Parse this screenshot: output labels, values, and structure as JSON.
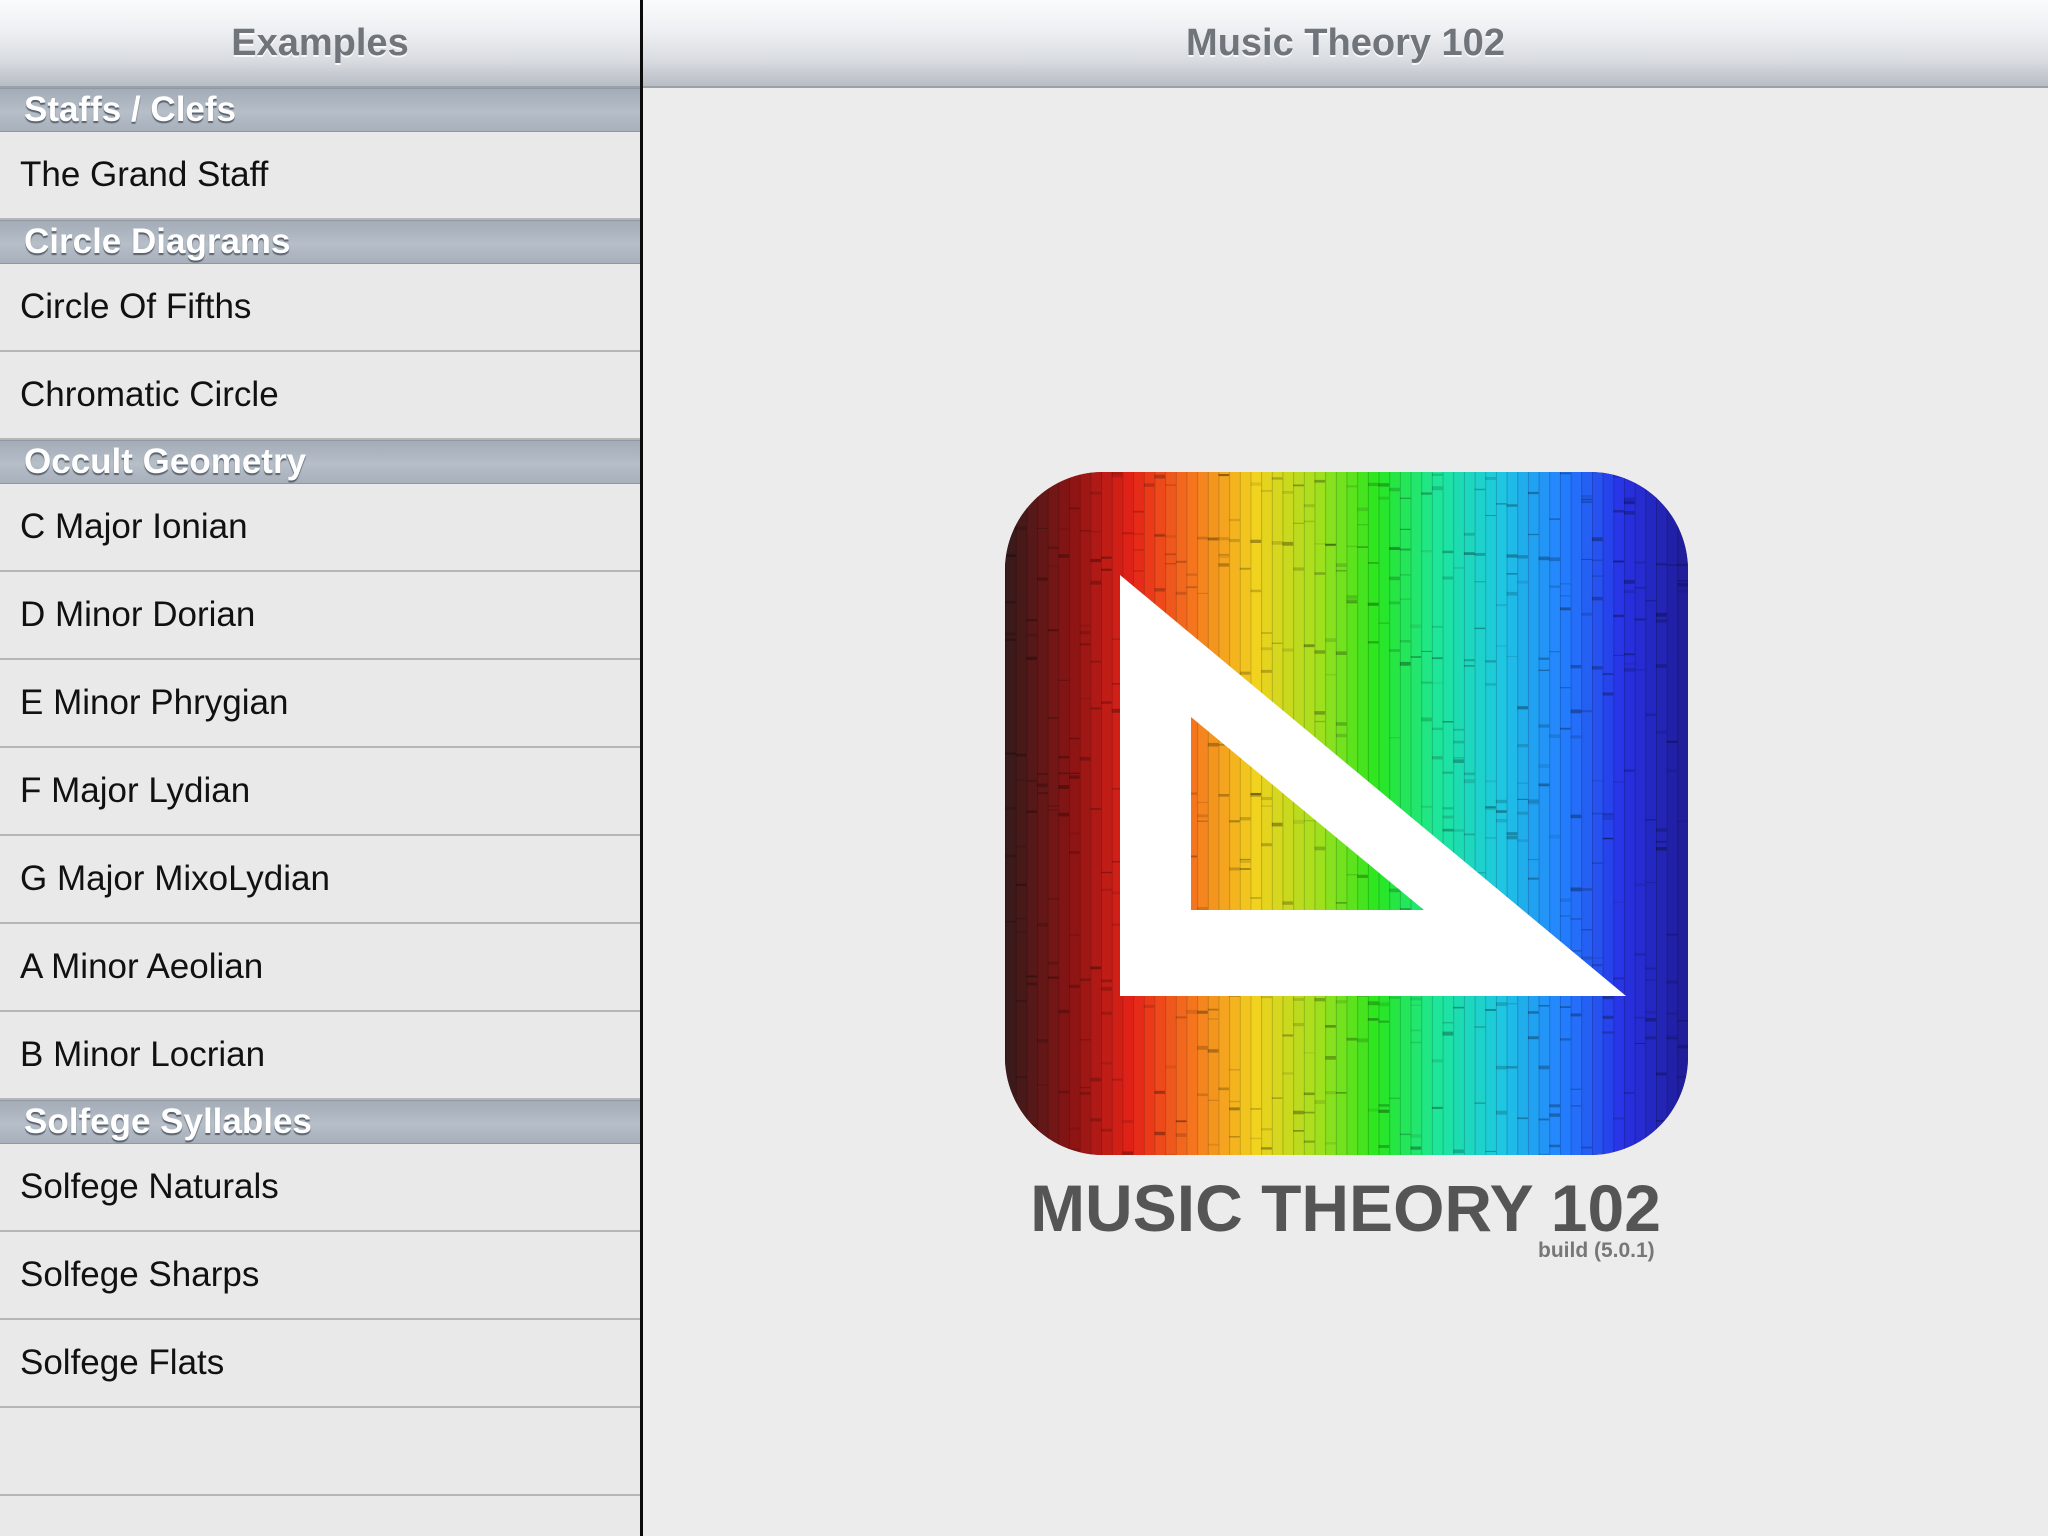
{
  "sidebar": {
    "title": "Examples",
    "sections": [
      {
        "header": "Staffs / Clefs",
        "items": [
          "The Grand Staff"
        ]
      },
      {
        "header": "Circle Diagrams",
        "items": [
          "Circle Of Fifths",
          "Chromatic Circle"
        ]
      },
      {
        "header": "Occult Geometry",
        "items": [
          "C Major Ionian",
          "D Minor Dorian",
          "E Minor Phrygian",
          "F Major Lydian",
          "G Major MixoLydian",
          "A Minor Aeolian",
          "B Minor Locrian"
        ]
      },
      {
        "header": "Solfege Syllables",
        "items": [
          "Solfege Naturals",
          "Solfege Sharps",
          "Solfege Flats"
        ]
      }
    ]
  },
  "main": {
    "title": "Music Theory 102",
    "logo": {
      "icon": "rainbow-set-square-icon",
      "spectrum_colors": [
        "#3a1a1a",
        "#8b1414",
        "#e62318",
        "#f5781e",
        "#f2d21e",
        "#a6df1e",
        "#28e61e",
        "#1ee69b",
        "#1ec8e1",
        "#2382ff",
        "#2832e6",
        "#201e9b"
      ]
    },
    "app_name": "MUSIC THEORY 102",
    "build": "build (5.0.1)"
  }
}
